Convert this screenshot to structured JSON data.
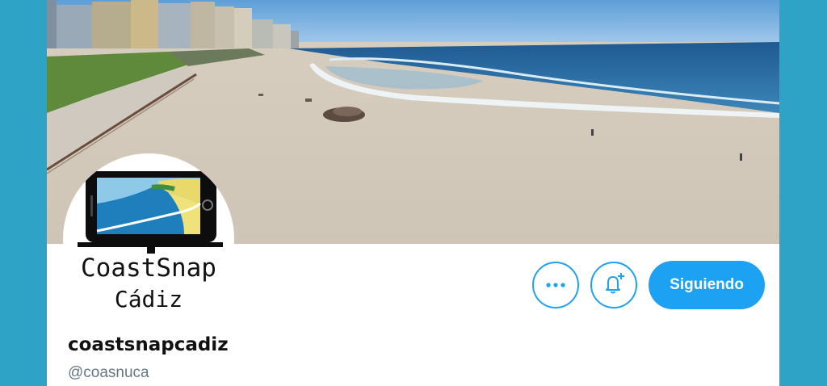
{
  "profile": {
    "avatar_line1": "CoastSnap",
    "avatar_line2": "Cádiz",
    "display_name": "coastsnapcadiz",
    "handle": "@coasnuca"
  },
  "actions": {
    "more_icon": "more-horizontal-icon",
    "notify_icon": "bell-plus-icon",
    "follow_label": "Siguiendo"
  },
  "colors": {
    "page_bg": "#2fa3c6",
    "accent": "#1da1f2",
    "handle_text": "#657786"
  }
}
